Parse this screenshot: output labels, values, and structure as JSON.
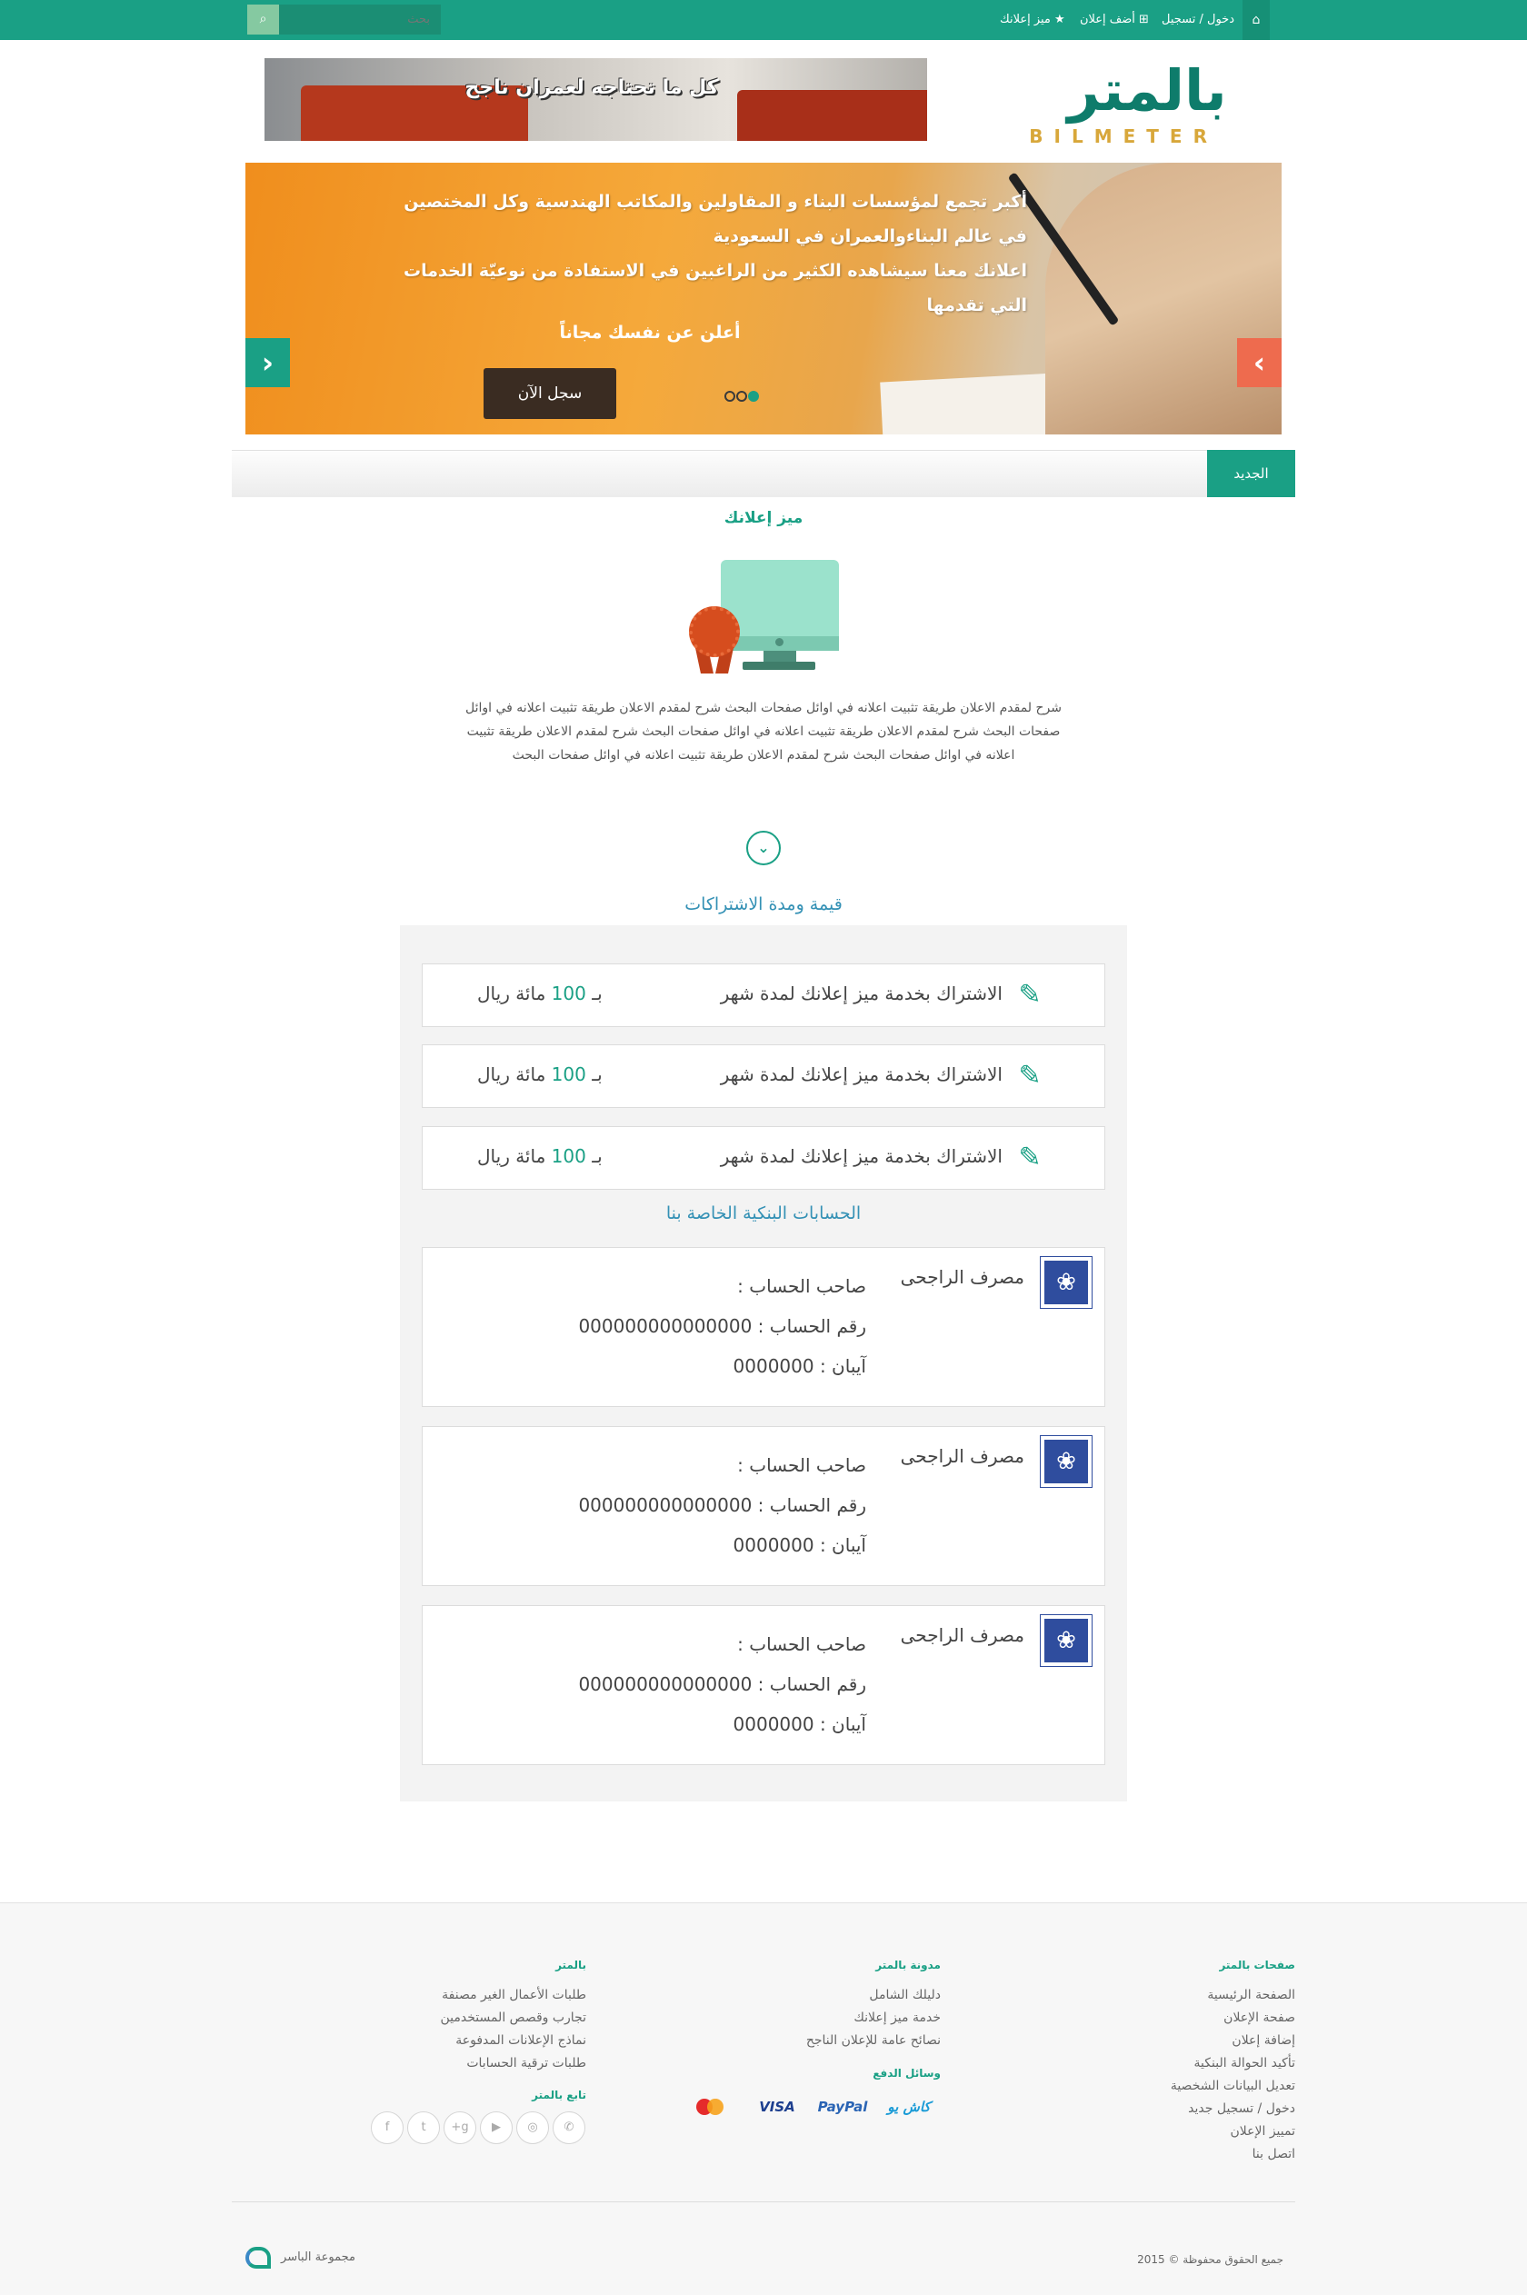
{
  "topbar": {
    "home_icon": "home-icon",
    "links": [
      {
        "label": "دخول / تسجيل",
        "icon": ""
      },
      {
        "label": "أضف إعلان",
        "icon": "plus-square-icon"
      },
      {
        "label": "ميز إعلانك",
        "icon": "star-icon"
      }
    ],
    "search_placeholder": "بحث",
    "search_icon": "search-icon",
    "bg_color": "#1aa085"
  },
  "header": {
    "logo_ar": "بالمتر",
    "logo_en": "BILMETER",
    "banner_text": "كل ما تحتاجه لعمران ناجح"
  },
  "slider": {
    "lines": [
      "أكبر تجمع لمؤسسات البناء و المقاولين والمكاتب الهندسية وكل المختصين",
      "في عالم البناءوالعمران في السعودية",
      "اعلانك معنا سيشاهده الكثير من الراغبين في الاستفادة من نوعيّة الخدمات",
      "التي تقدمها"
    ],
    "sub": "أعلن عن نفسك مجاناً",
    "cta": "سجل الآن",
    "prev_icon": "chevron-left-icon",
    "next_icon": "chevron-right-icon",
    "dots": 3,
    "active_dot": 1
  },
  "tabs": {
    "active": "الجديد"
  },
  "feature": {
    "title": "ميز إعلانك",
    "description": "شرح لمقدم الاعلان طريقة تثبيت اعلانه في اوائل صفحات البحث شرح لمقدم الاعلان طريقة تثبيت اعلانه في اوائل صفحات البحث شرح لمقدم الاعلان طريقة تثبيت اعلانه في اوائل صفحات البحث شرح لمقدم الاعلان طريقة تثبيت اعلانه في اوائل صفحات البحث شرح لمقدم الاعلان طريقة تثبيت اعلانه في اوائل صفحات البحث"
  },
  "subscriptions": {
    "title": "قيمة ومدة الاشتراكات",
    "plans": [
      {
        "label": "الاشتراك بخدمة ميز إعلانك لمدة شهر",
        "prefix": "بـ",
        "amount": "100",
        "suffix": "مائة ريال"
      },
      {
        "label": "الاشتراك بخدمة ميز إعلانك لمدة شهر",
        "prefix": "بـ",
        "amount": "100",
        "suffix": "مائة ريال"
      },
      {
        "label": "الاشتراك بخدمة ميز إعلانك لمدة شهر",
        "prefix": "بـ",
        "amount": "100",
        "suffix": "مائة ريال"
      }
    ]
  },
  "banks": {
    "title": "الحسابات البنكية الخاصة بنا",
    "items": [
      {
        "name": "مصرف الراجحى",
        "owner": "صاحب الحساب :",
        "account": "رقم الحساب : 000000000000000",
        "iban": "آيبان : 0000000"
      },
      {
        "name": "مصرف الراجحى",
        "owner": "صاحب الحساب :",
        "account": "رقم الحساب : 000000000000000",
        "iban": "آيبان : 0000000"
      },
      {
        "name": "مصرف الراجحى",
        "owner": "صاحب الحساب :",
        "account": "رقم الحساب : 000000000000000",
        "iban": "آيبان : 0000000"
      }
    ]
  },
  "footer": {
    "col1": {
      "title": "صفحات بالمتر",
      "links": [
        "الصفحة الرئيسية",
        "صفحة الإعلان",
        "إضافة إعلان",
        "تأكيد الحوالة البنكية",
        "تعديل البيانات الشخصية",
        "دخول / تسجيل جديد",
        "تمييز الإعلان",
        "اتصل بنا"
      ]
    },
    "col2": {
      "title": "مدونة بالمتر",
      "links": [
        "دليلك الشامل",
        "خدمة ميز إعلانك",
        "نصائح عامة للإعلان الناجح"
      ],
      "payments_title": "وسائل الدفع",
      "payments": [
        "كاش يو",
        "PayPal",
        "VISA",
        "MasterCard"
      ]
    },
    "col3": {
      "title": "بالمتر",
      "links": [
        "طلبات الأعمال الغير مصنفة",
        "تجارب وقصص المستخدمين",
        "نماذج الإعلانات المدفوعة",
        "طلبات ترقية الحسابات"
      ],
      "follow_title": "تابع بالمتر",
      "social": [
        "whatsapp-icon",
        "instagram-icon",
        "youtube-icon",
        "google-plus-icon",
        "twitter-icon",
        "facebook-icon"
      ]
    },
    "copyright": "جميع الحقوق محفوظة © 2015",
    "group": "مجموعة الباسر"
  }
}
